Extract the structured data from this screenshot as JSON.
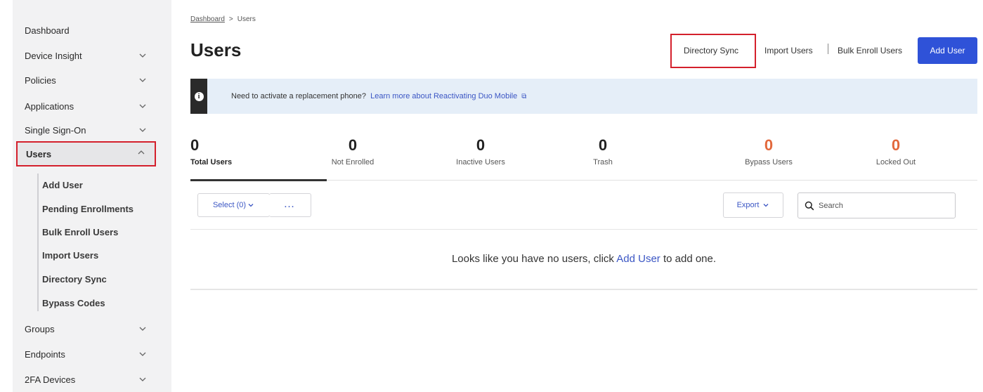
{
  "sidebar": {
    "items": [
      {
        "label": "Dashboard",
        "has_chevron": false
      },
      {
        "label": "Device Insight",
        "has_chevron": true
      },
      {
        "label": "Policies",
        "has_chevron": true
      },
      {
        "label": "Applications",
        "has_chevron": true
      },
      {
        "label": "Single Sign-On",
        "has_chevron": true
      },
      {
        "label": "Users",
        "has_chevron": true,
        "expanded": true,
        "active": true
      },
      {
        "label": "Groups",
        "has_chevron": true
      },
      {
        "label": "Endpoints",
        "has_chevron": true
      },
      {
        "label": "2FA Devices",
        "has_chevron": true
      }
    ],
    "users_subitems": [
      "Add User",
      "Pending Enrollments",
      "Bulk Enroll Users",
      "Import Users",
      "Directory Sync",
      "Bypass Codes"
    ]
  },
  "breadcrumb": {
    "root": "Dashboard",
    "separator": ">",
    "current": "Users"
  },
  "header": {
    "title": "Users",
    "directory_sync": "Directory Sync",
    "import_users": "Import Users",
    "bulk_enroll": "Bulk Enroll Users",
    "add_user": "Add User"
  },
  "banner": {
    "text": "Need to activate a replacement phone?",
    "link": "Learn more about Reactivating Duo Mobile"
  },
  "stats": [
    {
      "value": "0",
      "label": "Total Users"
    },
    {
      "value": "0",
      "label": "Not Enrolled"
    },
    {
      "value": "0",
      "label": "Inactive Users"
    },
    {
      "value": "0",
      "label": "Trash"
    },
    {
      "value": "0",
      "label": "Bypass Users"
    },
    {
      "value": "0",
      "label": "Locked Out"
    }
  ],
  "toolbar": {
    "select_label": "Select (0)",
    "more_label": "...",
    "export_label": "Export",
    "search_placeholder": "Search"
  },
  "empty": {
    "prefix": "Looks like you have no users, click",
    "link": "Add User",
    "suffix": "to add one."
  },
  "colors": {
    "accent": "#2f52d8",
    "highlight_box": "#d4202c",
    "warning": "#e2683c",
    "banner_bg": "#e5eef8"
  }
}
